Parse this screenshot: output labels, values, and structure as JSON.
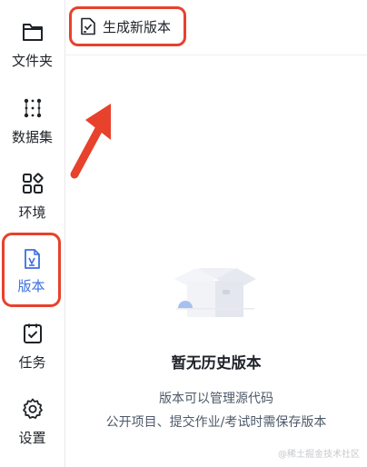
{
  "sidebar": {
    "items": [
      {
        "label": "文件夹",
        "icon": "folder-icon"
      },
      {
        "label": "数据集",
        "icon": "dataset-icon"
      },
      {
        "label": "环境",
        "icon": "environment-icon"
      },
      {
        "label": "版本",
        "icon": "version-file-icon",
        "active": true
      },
      {
        "label": "任务",
        "icon": "task-checklist-icon"
      },
      {
        "label": "设置",
        "icon": "gear-icon"
      }
    ]
  },
  "toolbar": {
    "generate_label": "生成新版本",
    "generate_icon": "new-version-icon"
  },
  "empty_state": {
    "title": "暂无历史版本",
    "line1": "版本可以管理源代码",
    "line2": "公开项目、提交作业/考试时需保存版本",
    "illustration": "empty-box-illustration"
  },
  "watermark": "@稀土掘金技术社区",
  "colors": {
    "accent": "#3b6fe0",
    "highlight_border": "#e8412c",
    "text": "#1f2329",
    "muted": "#4e5969"
  }
}
